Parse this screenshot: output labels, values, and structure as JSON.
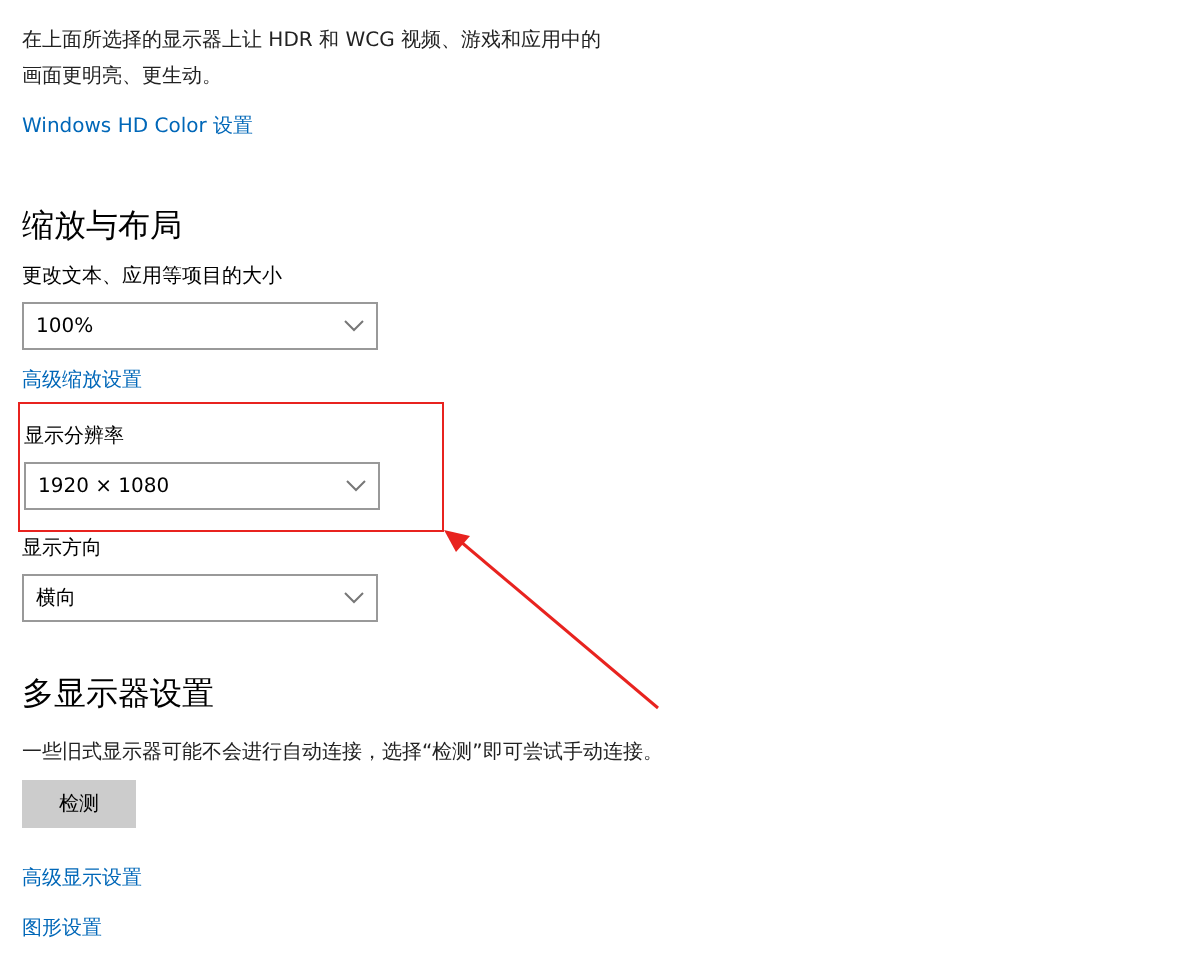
{
  "intro": {
    "text": "在上面所选择的显示器上让 HDR 和 WCG 视频、游戏和应用中的画面更明亮、更生动。",
    "link": "Windows HD Color 设置"
  },
  "sections": [
    {
      "heading": "缩放与布局",
      "items": [
        {
          "kind": "dropdown",
          "label": "更改文本、应用等项目的大小",
          "value": "100%",
          "highlighted": false
        },
        {
          "kind": "link",
          "text": "高级缩放设置"
        },
        {
          "kind": "dropdown",
          "label": "显示分辨率",
          "value": "1920 × 1080",
          "highlighted": true
        },
        {
          "kind": "dropdown",
          "label": "显示方向",
          "value": "横向",
          "highlighted": false
        }
      ]
    },
    {
      "heading": "多显示器设置",
      "items": [
        {
          "kind": "text",
          "text": "一些旧式显示器可能不会进行自动连接，选择“检测”即可尝试手动连接。"
        },
        {
          "kind": "button",
          "text": "检测"
        },
        {
          "kind": "link",
          "text": "高级显示设置"
        },
        {
          "kind": "link",
          "text": "图形设置"
        }
      ]
    }
  ]
}
